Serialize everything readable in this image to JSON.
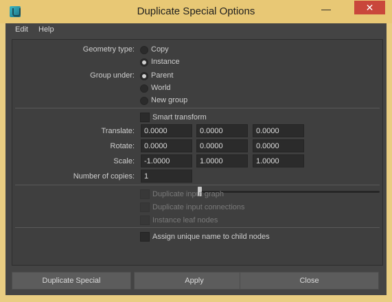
{
  "window": {
    "title": "Duplicate Special Options",
    "minimize_glyph": "—",
    "close_glyph": "✕"
  },
  "menu": {
    "edit": "Edit",
    "help": "Help"
  },
  "geometry_type": {
    "label": "Geometry type:",
    "options": [
      {
        "label": "Copy",
        "selected": false
      },
      {
        "label": "Instance",
        "selected": true
      }
    ]
  },
  "group_under": {
    "label": "Group under:",
    "options": [
      {
        "label": "Parent",
        "selected": true
      },
      {
        "label": "World",
        "selected": false
      },
      {
        "label": "New group",
        "selected": false
      }
    ]
  },
  "smart_transform": {
    "label": "Smart transform",
    "checked": false
  },
  "translate": {
    "label": "Translate:",
    "values": [
      "0.0000",
      "0.0000",
      "0.0000"
    ]
  },
  "rotate": {
    "label": "Rotate:",
    "values": [
      "0.0000",
      "0.0000",
      "0.0000"
    ]
  },
  "scale": {
    "label": "Scale:",
    "values": [
      "-1.0000",
      "1.0000",
      "1.0000"
    ]
  },
  "copies": {
    "label": "Number of copies:",
    "value": "1",
    "slider_fraction": 0.0
  },
  "options": {
    "duplicate_input_graph": {
      "label": "Duplicate input graph",
      "enabled": false
    },
    "duplicate_input_connections": {
      "label": "Duplicate input connections",
      "enabled": false
    },
    "instance_leaf_nodes": {
      "label": "Instance leaf nodes",
      "enabled": false
    },
    "assign_unique_name": {
      "label": "Assign unique name to child nodes",
      "enabled": true,
      "checked": false
    }
  },
  "buttons": {
    "duplicate_special": "Duplicate Special",
    "apply": "Apply",
    "close": "Close"
  },
  "colors": {
    "titlebar": "#e8c875",
    "background": "#444444",
    "panel": "#3f3f3f",
    "close_button": "#c9473b"
  }
}
